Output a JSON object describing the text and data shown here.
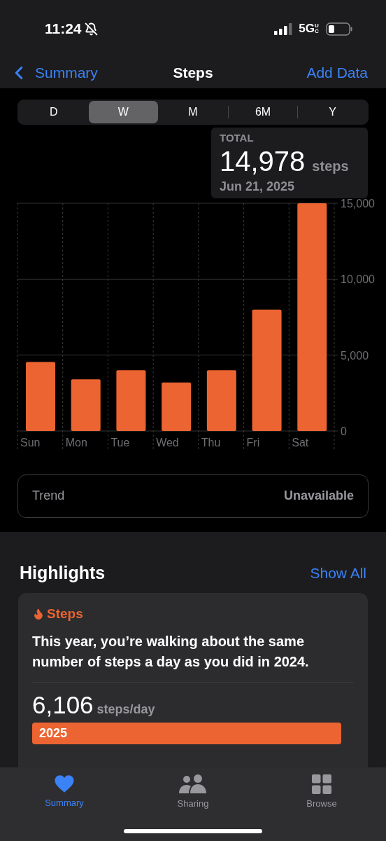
{
  "status_bar": {
    "time": "11:24",
    "network": "5G",
    "network_sub": "UC",
    "silent": true
  },
  "nav": {
    "back": "Summary",
    "title": "Steps",
    "action": "Add Data"
  },
  "periods": [
    {
      "label": "D",
      "selected": false
    },
    {
      "label": "W",
      "selected": true
    },
    {
      "label": "M",
      "selected": false
    },
    {
      "label": "6M",
      "selected": false
    },
    {
      "label": "Y",
      "selected": false
    }
  ],
  "tooltip": {
    "label": "TOTAL",
    "value": "14,978",
    "unit": "steps",
    "date": "Jun 21, 2025"
  },
  "chart_data": {
    "type": "bar",
    "categories": [
      "Sun",
      "Mon",
      "Tue",
      "Wed",
      "Thu",
      "Fri",
      "Sat"
    ],
    "series": [
      {
        "color": "#eb6431",
        "values": [
          4550,
          3400,
          4000,
          3200,
          4000,
          8000,
          15000
        ]
      }
    ],
    "ylim": [
      0,
      15000
    ],
    "yticks": [
      {
        "value": 0,
        "label": "0"
      },
      {
        "value": 5000,
        "label": "5,000"
      },
      {
        "value": 10000,
        "label": "10,000"
      },
      {
        "value": 15000,
        "label": "15,000"
      }
    ]
  },
  "trend": {
    "label": "Trend",
    "value": "Unavailable"
  },
  "highlights": {
    "title": "Highlights",
    "show_all": "Show All",
    "card": {
      "category": "Steps",
      "text": "This year, you’re walking about the same number of steps a day as you did in 2024.",
      "stats": [
        {
          "value": "6,106",
          "unit": "steps/day",
          "bar_label": "2025"
        }
      ]
    }
  },
  "tab_bar": [
    {
      "label": "Summary",
      "selected": true
    },
    {
      "label": "Sharing",
      "selected": false
    },
    {
      "label": "Browse",
      "selected": false
    }
  ]
}
